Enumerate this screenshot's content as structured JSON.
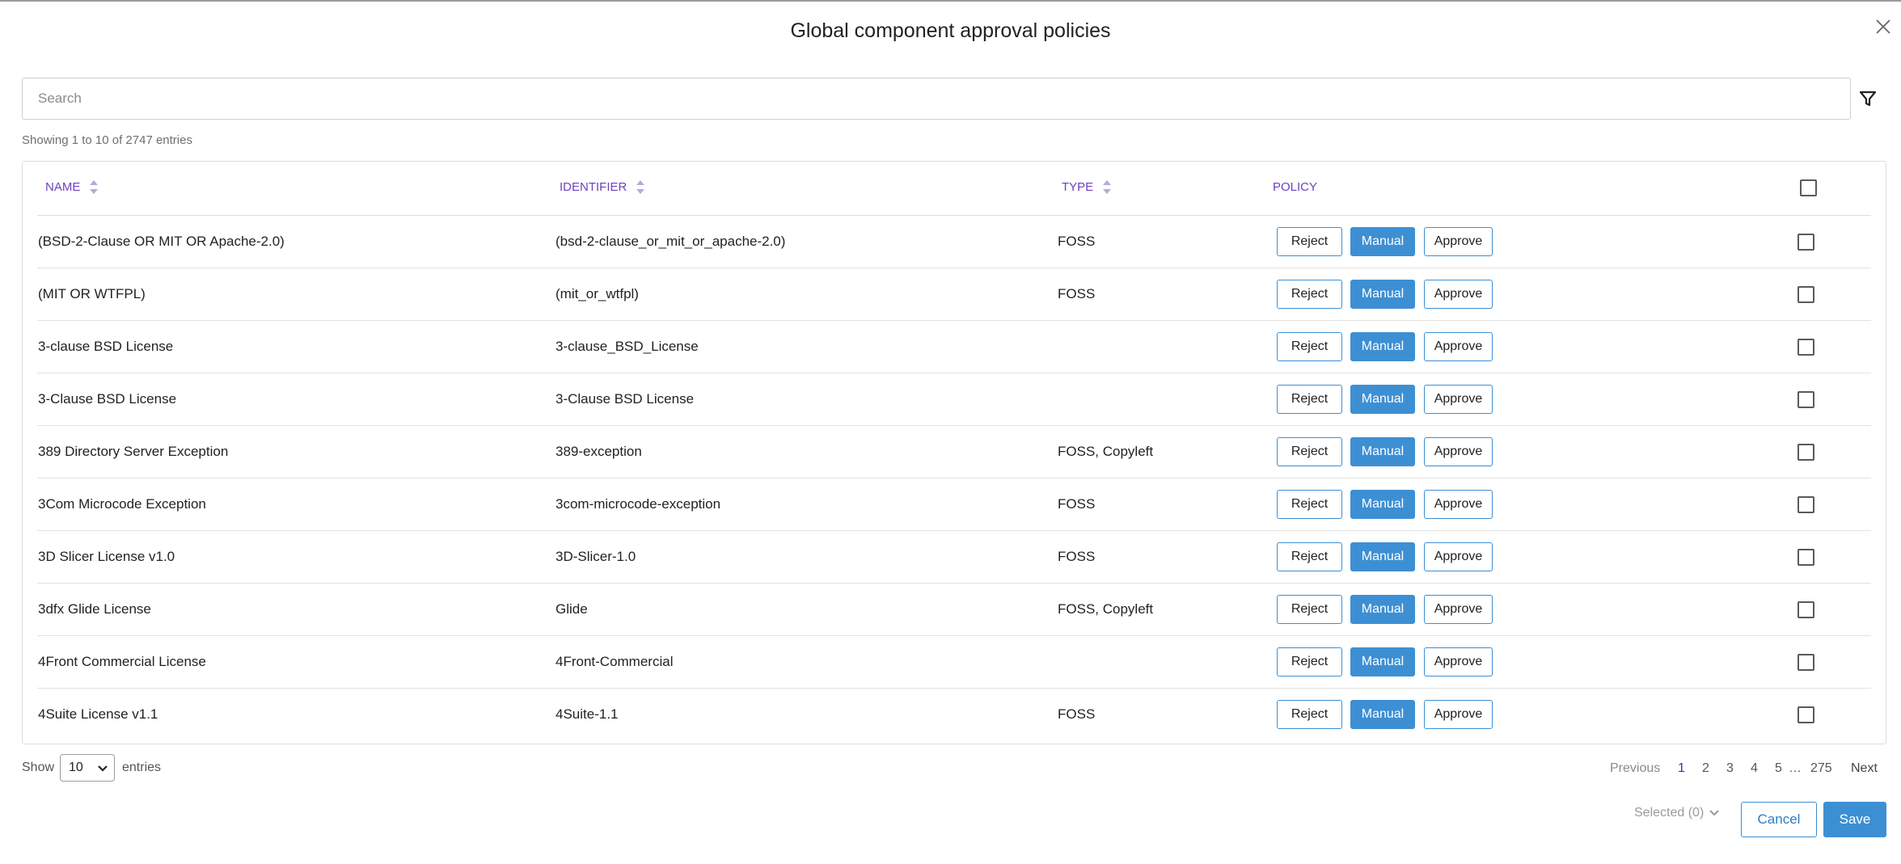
{
  "modal": {
    "title": "Global component approval policies"
  },
  "search": {
    "placeholder": "Search"
  },
  "icons": {
    "close": "close-icon",
    "filter": "filter-icon",
    "sort": "sort-icon",
    "dropdown": "chevron-down-icon"
  },
  "colors": {
    "accent": "#3d8fd4",
    "header_text": "#6f3fbf",
    "muted": "#8a8a8a"
  },
  "table": {
    "info": "Showing 1 to 10 of 2747 entries",
    "columns": {
      "name": "NAME",
      "identifier": "IDENTIFIER",
      "type": "TYPE",
      "policy": "POLICY"
    },
    "policy_buttons": {
      "reject": "Reject",
      "manual": "Manual",
      "approve": "Approve"
    },
    "active_policy": "Manual",
    "rows": [
      {
        "name": "(BSD-2-Clause OR MIT OR Apache-2.0)",
        "identifier": "(bsd-2-clause_or_mit_or_apache-2.0)",
        "type": "FOSS",
        "checked": false
      },
      {
        "name": "(MIT OR WTFPL)",
        "identifier": "(mit_or_wtfpl)",
        "type": "FOSS",
        "checked": false
      },
      {
        "name": "3-clause BSD License",
        "identifier": "3-clause_BSD_License",
        "type": "",
        "checked": false
      },
      {
        "name": "3-Clause BSD License",
        "identifier": "3-Clause BSD License",
        "type": "",
        "checked": false
      },
      {
        "name": "389 Directory Server Exception",
        "identifier": "389-exception",
        "type": "FOSS, Copyleft",
        "checked": false
      },
      {
        "name": "3Com Microcode Exception",
        "identifier": "3com-microcode-exception",
        "type": "FOSS",
        "checked": false
      },
      {
        "name": "3D Slicer License v1.0",
        "identifier": "3D-Slicer-1.0",
        "type": "FOSS",
        "checked": false
      },
      {
        "name": "3dfx Glide License",
        "identifier": "Glide",
        "type": "FOSS, Copyleft",
        "checked": false
      },
      {
        "name": "4Front Commercial License",
        "identifier": "4Front-Commercial",
        "type": "",
        "checked": false
      },
      {
        "name": "4Suite License v1.1",
        "identifier": "4Suite-1.1",
        "type": "FOSS",
        "checked": false
      }
    ]
  },
  "footer": {
    "show_label": "Show",
    "page_length": "10",
    "entries_label": "entries",
    "pagination": {
      "previous": "Previous",
      "pages": [
        "1",
        "2",
        "3",
        "4",
        "5"
      ],
      "current": "1",
      "ellipsis": "…",
      "last": "275",
      "next": "Next"
    },
    "selected": "Selected (0)",
    "cancel": "Cancel",
    "save": "Save"
  }
}
